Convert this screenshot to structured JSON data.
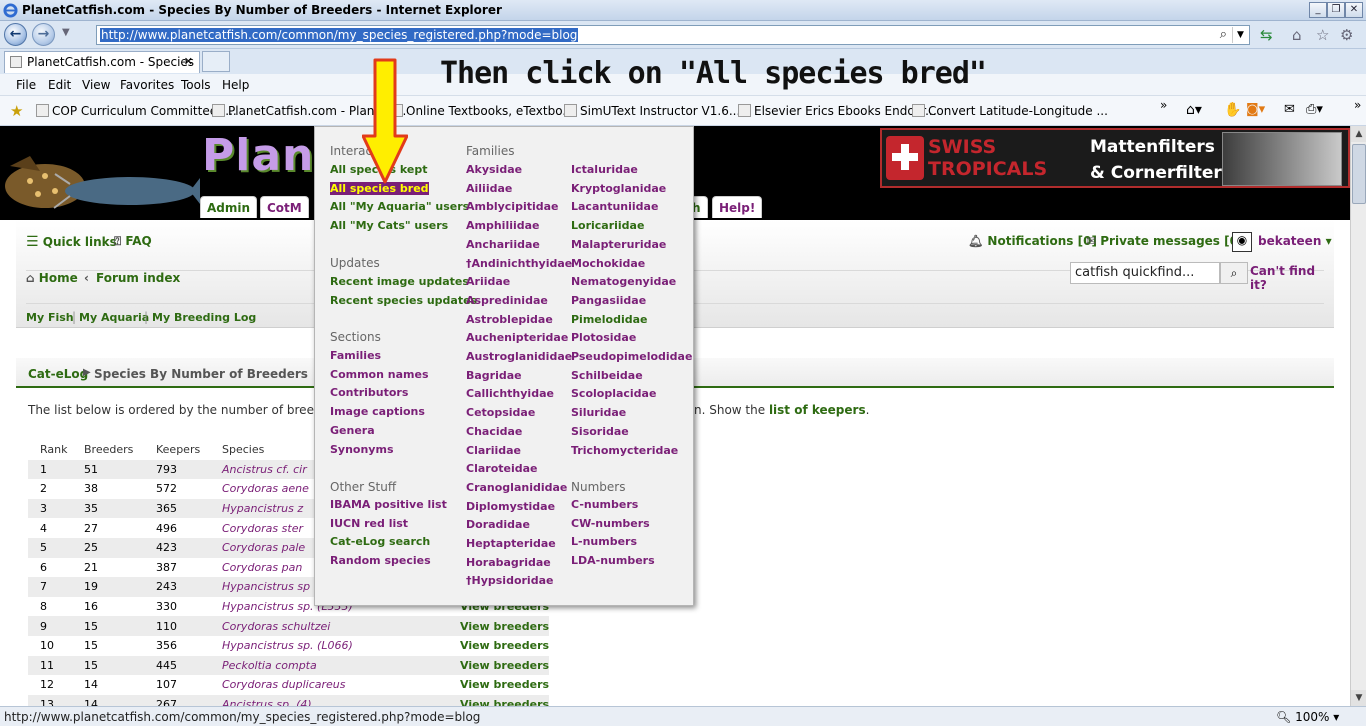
{
  "window": {
    "title": "PlanetCatfish.com - Species By Number of Breeders - Internet Explorer"
  },
  "address": {
    "url": "http://www.planetcatfish.com/common/my_species_registered.php?mode=blog"
  },
  "tab": {
    "label": "PlanetCatfish.com - Species ..."
  },
  "menubar": [
    "File",
    "Edit",
    "View",
    "Favorites",
    "Tools",
    "Help"
  ],
  "favorites": [
    "COP Curriculum Committee -...",
    "PlanetCatfish.com - PlanetC...",
    "Online Textbooks, eTextbo...",
    "SimUText Instructor  V1.6....",
    "Elsevier Erics Ebooks Endocr...",
    "Convert Latitude-Longitude ..."
  ],
  "annotation": "Then click on \"All species bred\"",
  "site": {
    "logo": "Planet",
    "ad": {
      "brand_line1": "SWISS",
      "brand_line2": "TROPICALS",
      "product_line1": "Mattenfilters",
      "product_line2": "& Cornerfilters"
    },
    "nav_tabs": [
      "Admin",
      "CotM",
      "Help!"
    ],
    "nav_tab_hidden": "h",
    "quick_links": "Quick links",
    "faq": "FAQ",
    "notifications": "Notifications [0]",
    "private_messages": "Private messages [0]",
    "username": "bekateen",
    "home": "Home",
    "forum_index": "Forum index",
    "search_placeholder": "catfish quickfind...",
    "cant_find": "Can't find it?",
    "sub_links": [
      "My Fish",
      "My Aquaria",
      "My Breeding Log"
    ]
  },
  "breadcrumb": {
    "root": "Cat-eLog",
    "page": "Species By Number of Breeders"
  },
  "intro": {
    "text_left": "The list below is ordered by the number of breede",
    "text_right": "n. Show the ",
    "link": "list of keepers",
    "end": "."
  },
  "table": {
    "headers": [
      "Rank",
      "Breeders",
      "Keepers",
      "Species"
    ],
    "rows": [
      {
        "rank": "1",
        "breeders": "51",
        "keepers": "793",
        "species": "Ancistrus cf. cir",
        "action": ""
      },
      {
        "rank": "2",
        "breeders": "38",
        "keepers": "572",
        "species": "Corydoras aene",
        "action": ""
      },
      {
        "rank": "3",
        "breeders": "35",
        "keepers": "365",
        "species": "Hypancistrus z",
        "action": ""
      },
      {
        "rank": "4",
        "breeders": "27",
        "keepers": "496",
        "species": "Corydoras ster",
        "action": ""
      },
      {
        "rank": "5",
        "breeders": "25",
        "keepers": "423",
        "species": "Corydoras pale",
        "action": ""
      },
      {
        "rank": "6",
        "breeders": "21",
        "keepers": "387",
        "species": "Corydoras pan",
        "action": ""
      },
      {
        "rank": "7",
        "breeders": "19",
        "keepers": "243",
        "species": "Hypancistrus sp",
        "action": ""
      },
      {
        "rank": "8",
        "breeders": "16",
        "keepers": "330",
        "species": "Hypancistrus sp. (L333)",
        "action": "View breeders"
      },
      {
        "rank": "9",
        "breeders": "15",
        "keepers": "110",
        "species": "Corydoras schultzei",
        "action": "View breeders"
      },
      {
        "rank": "10",
        "breeders": "15",
        "keepers": "356",
        "species": "Hypancistrus sp. (L066)",
        "action": "View breeders"
      },
      {
        "rank": "11",
        "breeders": "15",
        "keepers": "445",
        "species": "Peckoltia compta",
        "action": "View breeders"
      },
      {
        "rank": "12",
        "breeders": "14",
        "keepers": "107",
        "species": "Corydoras duplicareus",
        "action": "View breeders"
      },
      {
        "rank": "13",
        "breeders": "14",
        "keepers": "267",
        "species": "Ancistrus sp. (4)",
        "action": "View breeders"
      }
    ]
  },
  "dropdown": {
    "interactive_header": "Interac",
    "interactive": [
      "All species kept",
      "All species bred",
      "All \"My Aquaria\" users",
      "All \"My Cats\" users"
    ],
    "updates_header": "Updates",
    "updates": [
      "Recent image updates",
      "Recent species updates"
    ],
    "sections_header": "Sections",
    "sections": [
      "Families",
      "Common names",
      "Contributors",
      "Image captions",
      "Genera",
      "Synonyms"
    ],
    "other_header": "Other Stuff",
    "other": [
      "IBAMA positive list",
      "IUCN red list",
      "Cat-eLog search",
      "Random species"
    ],
    "families_header": "Families",
    "families_col1": [
      "Akysidae",
      "Ailiidae",
      "Amblycipitidae",
      "Amphiliidae",
      "Anchariidae",
      "†Andinichthyidae",
      "Ariidae",
      "Aspredinidae",
      "Astroblepidae",
      "Auchenipteridae",
      "Austroglanididae",
      "Bagridae",
      "Callichthyidae",
      "Cetopsidae",
      "Chacidae",
      "Clariidae",
      "Claroteidae",
      "Cranoglanididae",
      "Diplomystidae",
      "Doradidae",
      "Heptapteridae",
      "Horabagridae",
      "†Hypsidoridae"
    ],
    "families_col2": [
      "Ictaluridae",
      "Kryptoglanidae",
      "Lacantuniidae",
      "Loricariidae",
      "Malapteruridae",
      "Mochokidae",
      "Nematogenyidae",
      "Pangasiidae",
      "Pimelodidae",
      "Plotosidae",
      "Pseudopimelodidae",
      "Schilbeidae",
      "Scoloplacidae",
      "Siluridae",
      "Sisoridae",
      "Trichomycteridae"
    ],
    "numbers_header": "Numbers",
    "numbers": [
      "C-numbers",
      "CW-numbers",
      "L-numbers",
      "LDA-numbers"
    ]
  },
  "status": {
    "text": "http://www.planetcatfish.com/common/my_species_registered.php?mode=blog",
    "zoom": "100%"
  },
  "colors": {
    "site_green": "#2e6b12",
    "site_purple": "#7a1f77",
    "highlight": "#ffff00",
    "arrow": "#ffee00"
  }
}
